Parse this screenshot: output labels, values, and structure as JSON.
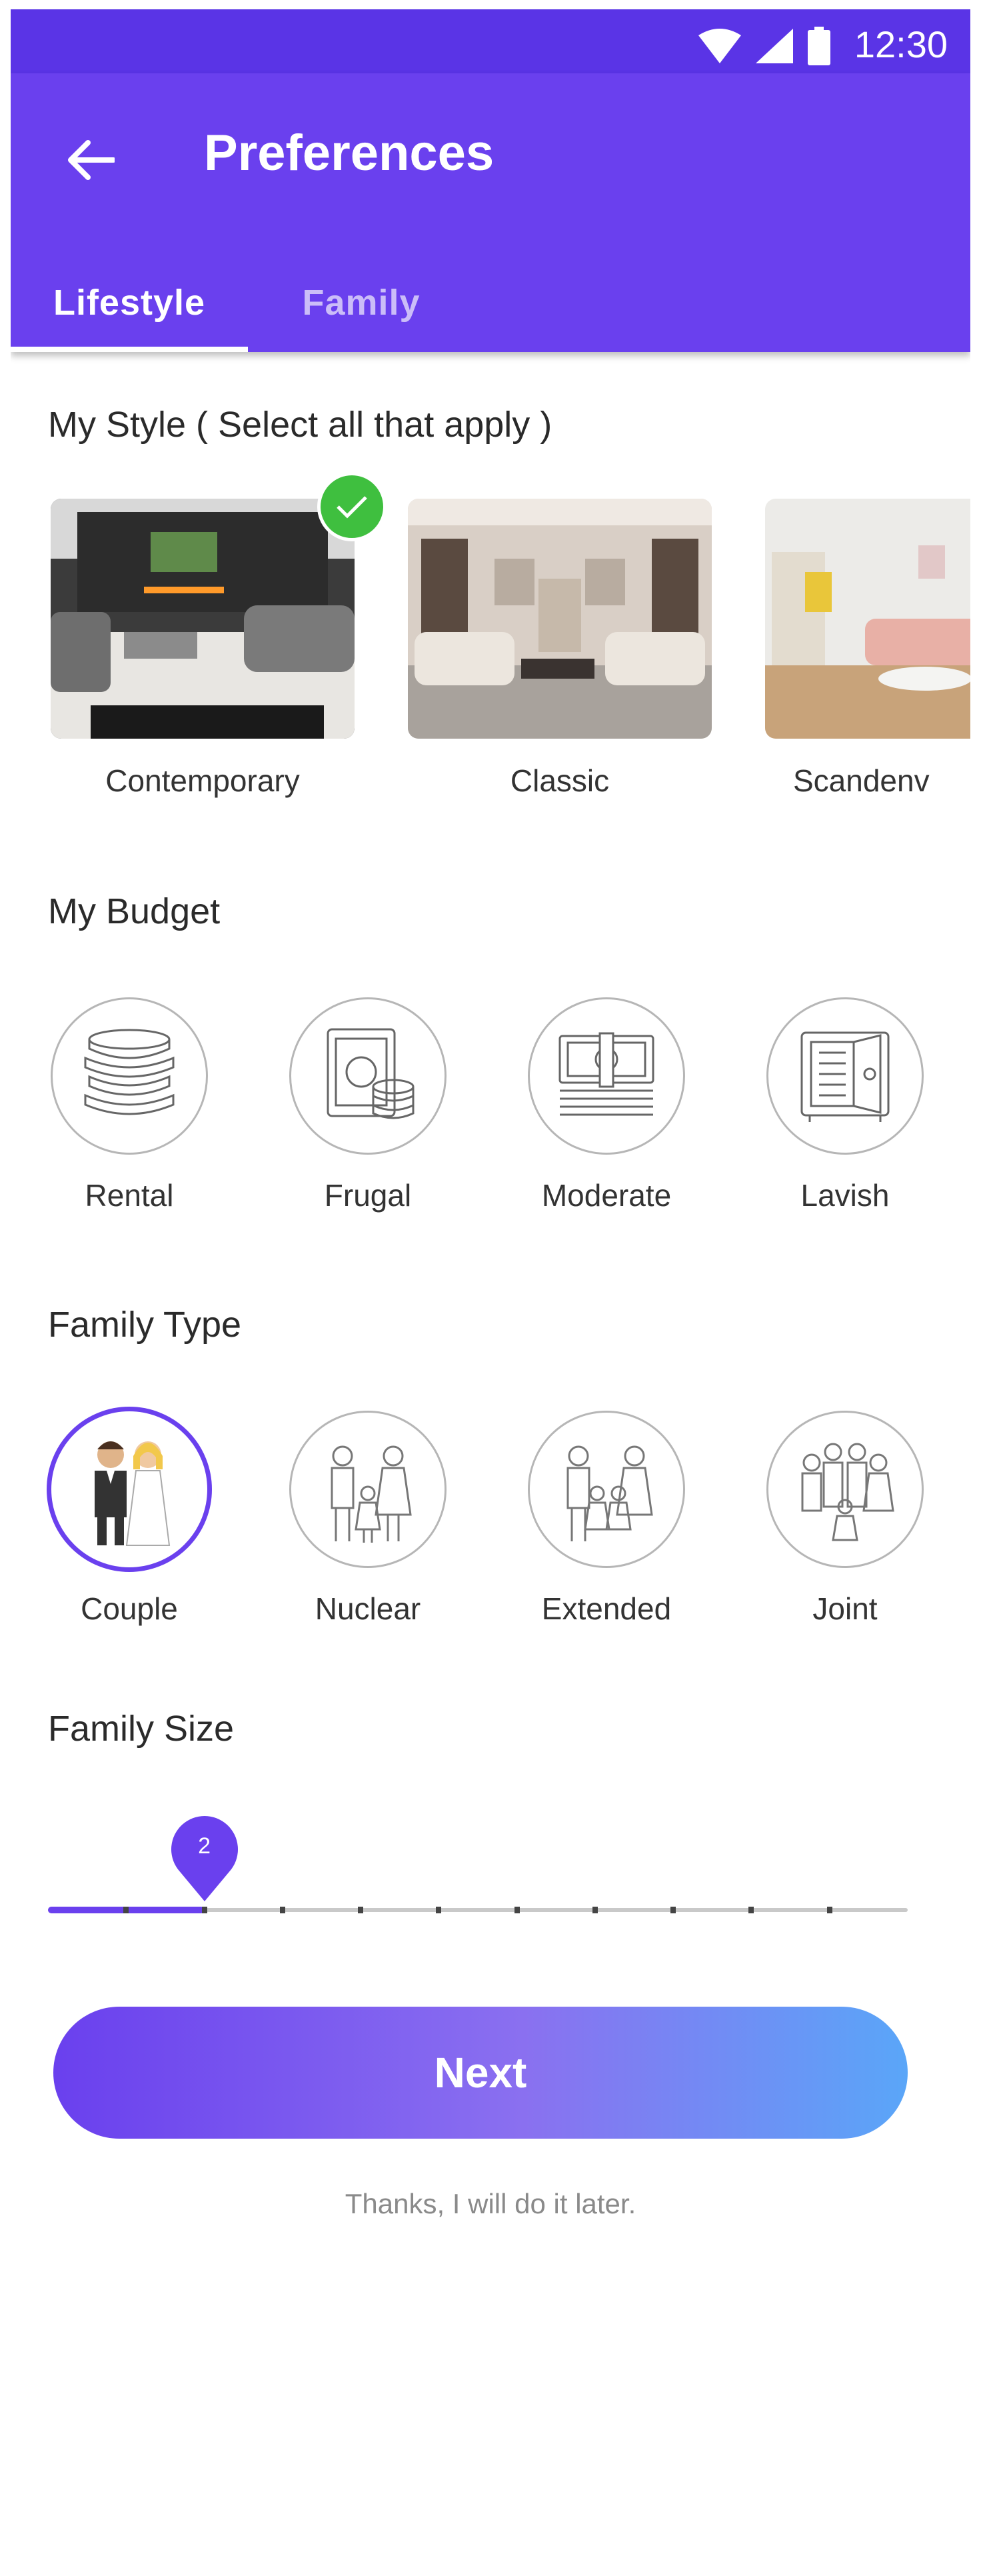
{
  "status_bar": {
    "time": "12:30"
  },
  "app_bar": {
    "title": "Preferences",
    "tabs": [
      {
        "label": "Lifestyle",
        "active": true
      },
      {
        "label": "Family",
        "active": false
      }
    ]
  },
  "sections": {
    "style_title": "My Style ( Select all that apply )",
    "budget_title": "My Budget",
    "family_type_title": "Family Type",
    "family_size_title": "Family Size"
  },
  "styles": [
    {
      "label": "Contemporary",
      "selected": true
    },
    {
      "label": "Classic",
      "selected": false
    },
    {
      "label": "Scandenv",
      "selected": false
    }
  ],
  "budget_options": [
    {
      "label": "Rental",
      "icon": "coins-icon"
    },
    {
      "label": "Frugal",
      "icon": "cash-coins-icon"
    },
    {
      "label": "Moderate",
      "icon": "banknotes-icon"
    },
    {
      "label": "Lavish",
      "icon": "safe-icon"
    }
  ],
  "family_types": [
    {
      "label": "Couple",
      "icon": "couple-icon",
      "selected": true
    },
    {
      "label": "Nuclear",
      "icon": "nuclear-family-icon",
      "selected": false
    },
    {
      "label": "Extended",
      "icon": "extended-family-icon",
      "selected": false
    },
    {
      "label": "Joint",
      "icon": "joint-family-icon",
      "selected": false
    }
  ],
  "family_size": {
    "value": "2",
    "min": 0,
    "max": 11
  },
  "actions": {
    "next_label": "Next",
    "later_label": "Thanks, I will do it later."
  },
  "colors": {
    "primary": "#6a40ee",
    "status_bar": "#5a34e6",
    "check": "#3fbf3f",
    "gradient_end": "#5aa6f8"
  }
}
